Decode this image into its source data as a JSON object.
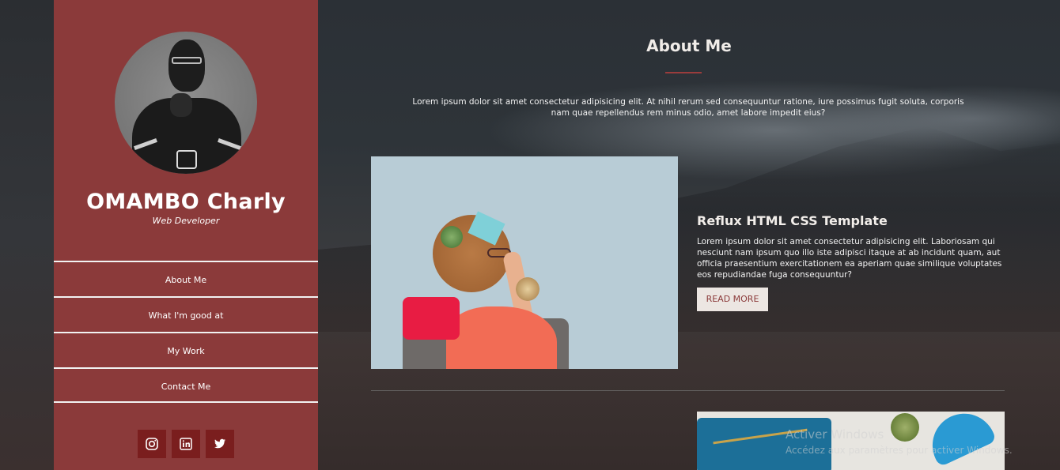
{
  "profile": {
    "name": "OMAMBO Charly",
    "role": "Web Developer"
  },
  "nav": {
    "items": [
      {
        "label": "About Me"
      },
      {
        "label": "What I'm good at"
      },
      {
        "label": "My Work"
      },
      {
        "label": "Contact Me"
      }
    ]
  },
  "social": {
    "icons": [
      "instagram-icon",
      "linkedin-icon",
      "twitter-icon"
    ]
  },
  "about": {
    "title": "About Me",
    "intro": "Lorem ipsum dolor sit amet consectetur adipisicing elit. At nihil rerum sed consequuntur ratione, iure possimus fugit soluta, corporis nam quae repellendus rem minus odio, amet labore impedit eius?"
  },
  "cards": [
    {
      "title": "Reflux HTML CSS Template",
      "text": "Lorem ipsum dolor sit amet consectetur adipisicing elit. Laboriosam qui nesciunt nam ipsum quo illo iste adipisci itaque at ab incidunt quam, aut officia praesentium exercitationem ea aperiam quae similique voluptates eos repudiandae fuga consequuntur?",
      "button": "READ MORE"
    }
  ],
  "watermark": {
    "title": "Activer Windows",
    "subtitle": "Accédez aux paramètres pour activer Windows."
  },
  "colors": {
    "sidebar": "#8b3a3a",
    "social_button": "#7a1e1e",
    "accent_underline": "#9a3c3c",
    "button_bg": "#ece6e2"
  }
}
